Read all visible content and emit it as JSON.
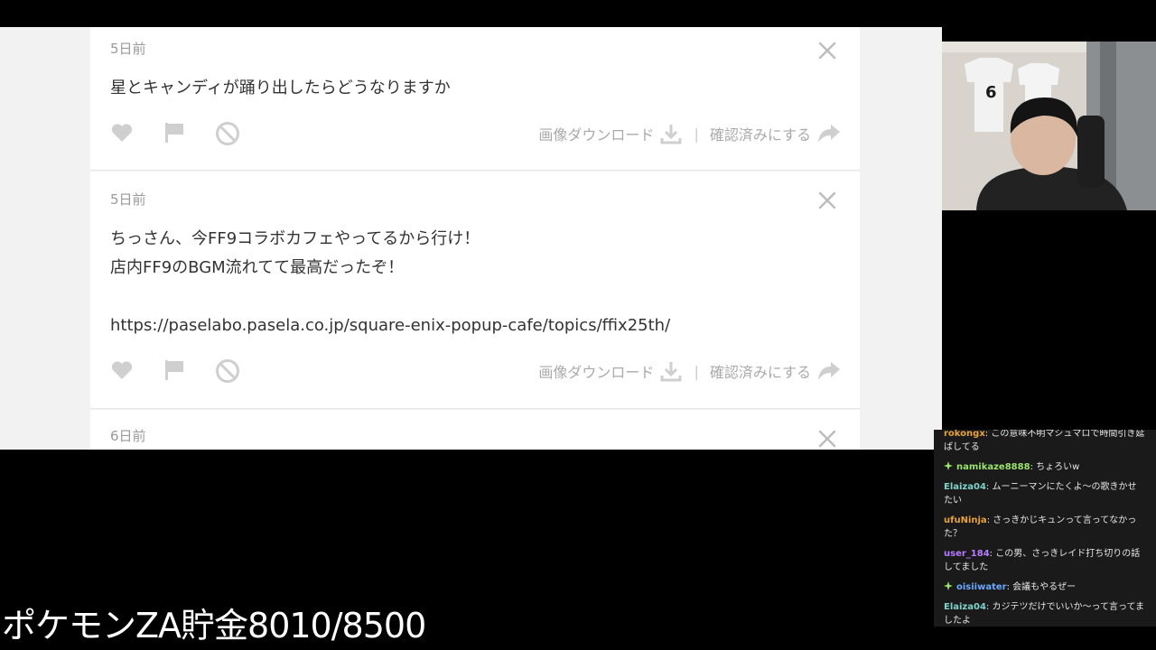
{
  "messages": [
    {
      "date": "5日前",
      "lines": [
        "星とキャンディが踊り出したらどうなりますか"
      ],
      "download_label": "画像ダウンロード",
      "confirm_label": "確認済みにする"
    },
    {
      "date": "5日前",
      "lines": [
        "ちっさん、今FF9コラボカフェやってるから行け！",
        "店内FF9のBGM流れてて最高だったぞ！",
        "",
        "https://paselabo.pasela.co.jp/square-enix-popup-cafe/topics/ffix25th/"
      ],
      "download_label": "画像ダウンロード",
      "confirm_label": "確認済みにする"
    },
    {
      "date": "6日前"
    }
  ],
  "chat": [
    {
      "user": "rokongx",
      "color": "#e8a23c",
      "text": "この意味不明マシュマロで時間引き延ばしてる",
      "badge": false
    },
    {
      "user": "namikaze8888",
      "color": "#9be36b",
      "text": "ちょろいw",
      "badge": true
    },
    {
      "user": "Elaiza04",
      "color": "#7fd3c9",
      "text": "ムーニーマンにたくよ〜の歌きかせたい",
      "badge": false
    },
    {
      "user": "ufuNinja",
      "color": "#e8a23c",
      "text": "さっきかじキュンって言ってなかった？",
      "badge": false
    },
    {
      "user": "user_184",
      "color": "#b57bff",
      "text": "この男、さっきレイド打ち切りの話してました",
      "badge": false
    },
    {
      "user": "oisiiwater",
      "color": "#6aa9ff",
      "text": "会議もやるぜー",
      "badge": true
    },
    {
      "user": "Elaiza04",
      "color": "#7fd3c9",
      "text": "カジテツだけでいいか〜って言ってましたよ",
      "badge": false
    }
  ],
  "overlay": {
    "savings_text": "ポケモンZA貯金8010/8500"
  },
  "icons": {
    "like": "heart-icon",
    "flag": "flag-icon",
    "block": "block-icon",
    "download": "download-icon",
    "forward": "share-arrow-icon",
    "close": "close-icon",
    "badge": "sparkle-badge-icon"
  }
}
